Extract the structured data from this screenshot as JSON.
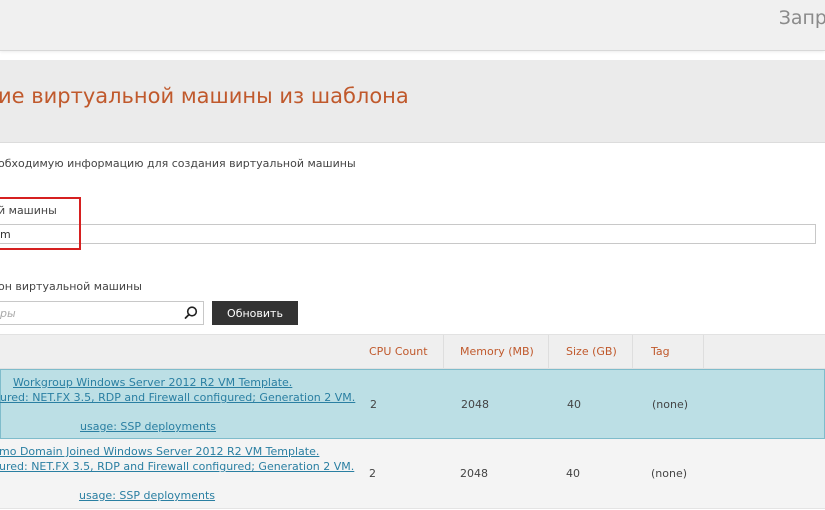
{
  "topbar": {
    "title": "Запр"
  },
  "page": {
    "title": "ие виртуальной машины из шаблона",
    "instructions": "обходимую информацию для создания виртуальной машины"
  },
  "name_field": {
    "label": "й машины",
    "value": "m"
  },
  "template_section": {
    "label": "он виртуальной машины",
    "filter_placeholder": "ры",
    "refresh_label": "Обновить"
  },
  "table": {
    "columns": [
      "",
      "CPU Count",
      "Memory (MB)",
      "Size (GB)",
      "Tag"
    ],
    "rows": [
      {
        "line1": "Workgroup Windows Server 2012 R2 VM Template.",
        "line2": "ured: NET.FX 3.5, RDP and Firewall configured; Generation 2 VM.",
        "line3": "usage: SSP deployments",
        "cpu": "2",
        "memory": "2048",
        "size": "40",
        "tag": "(none)",
        "selected": true
      },
      {
        "line1": "mo Domain Joined Windows Server 2012 R2 VM Template.",
        "line2": "ured: NET.FX 3.5, RDP and Firewall configured; Generation 2 VM.",
        "line3": "usage: SSP deployments",
        "cpu": "2",
        "memory": "2048",
        "size": "40",
        "tag": "(none)",
        "selected": false
      }
    ]
  },
  "colors": {
    "accent": "#c0592c",
    "selected_row": "#bcdfe5",
    "link": "#2a7fa2",
    "highlight": "#d62020",
    "button": "#333333"
  },
  "icons": {
    "search": "search-icon"
  }
}
